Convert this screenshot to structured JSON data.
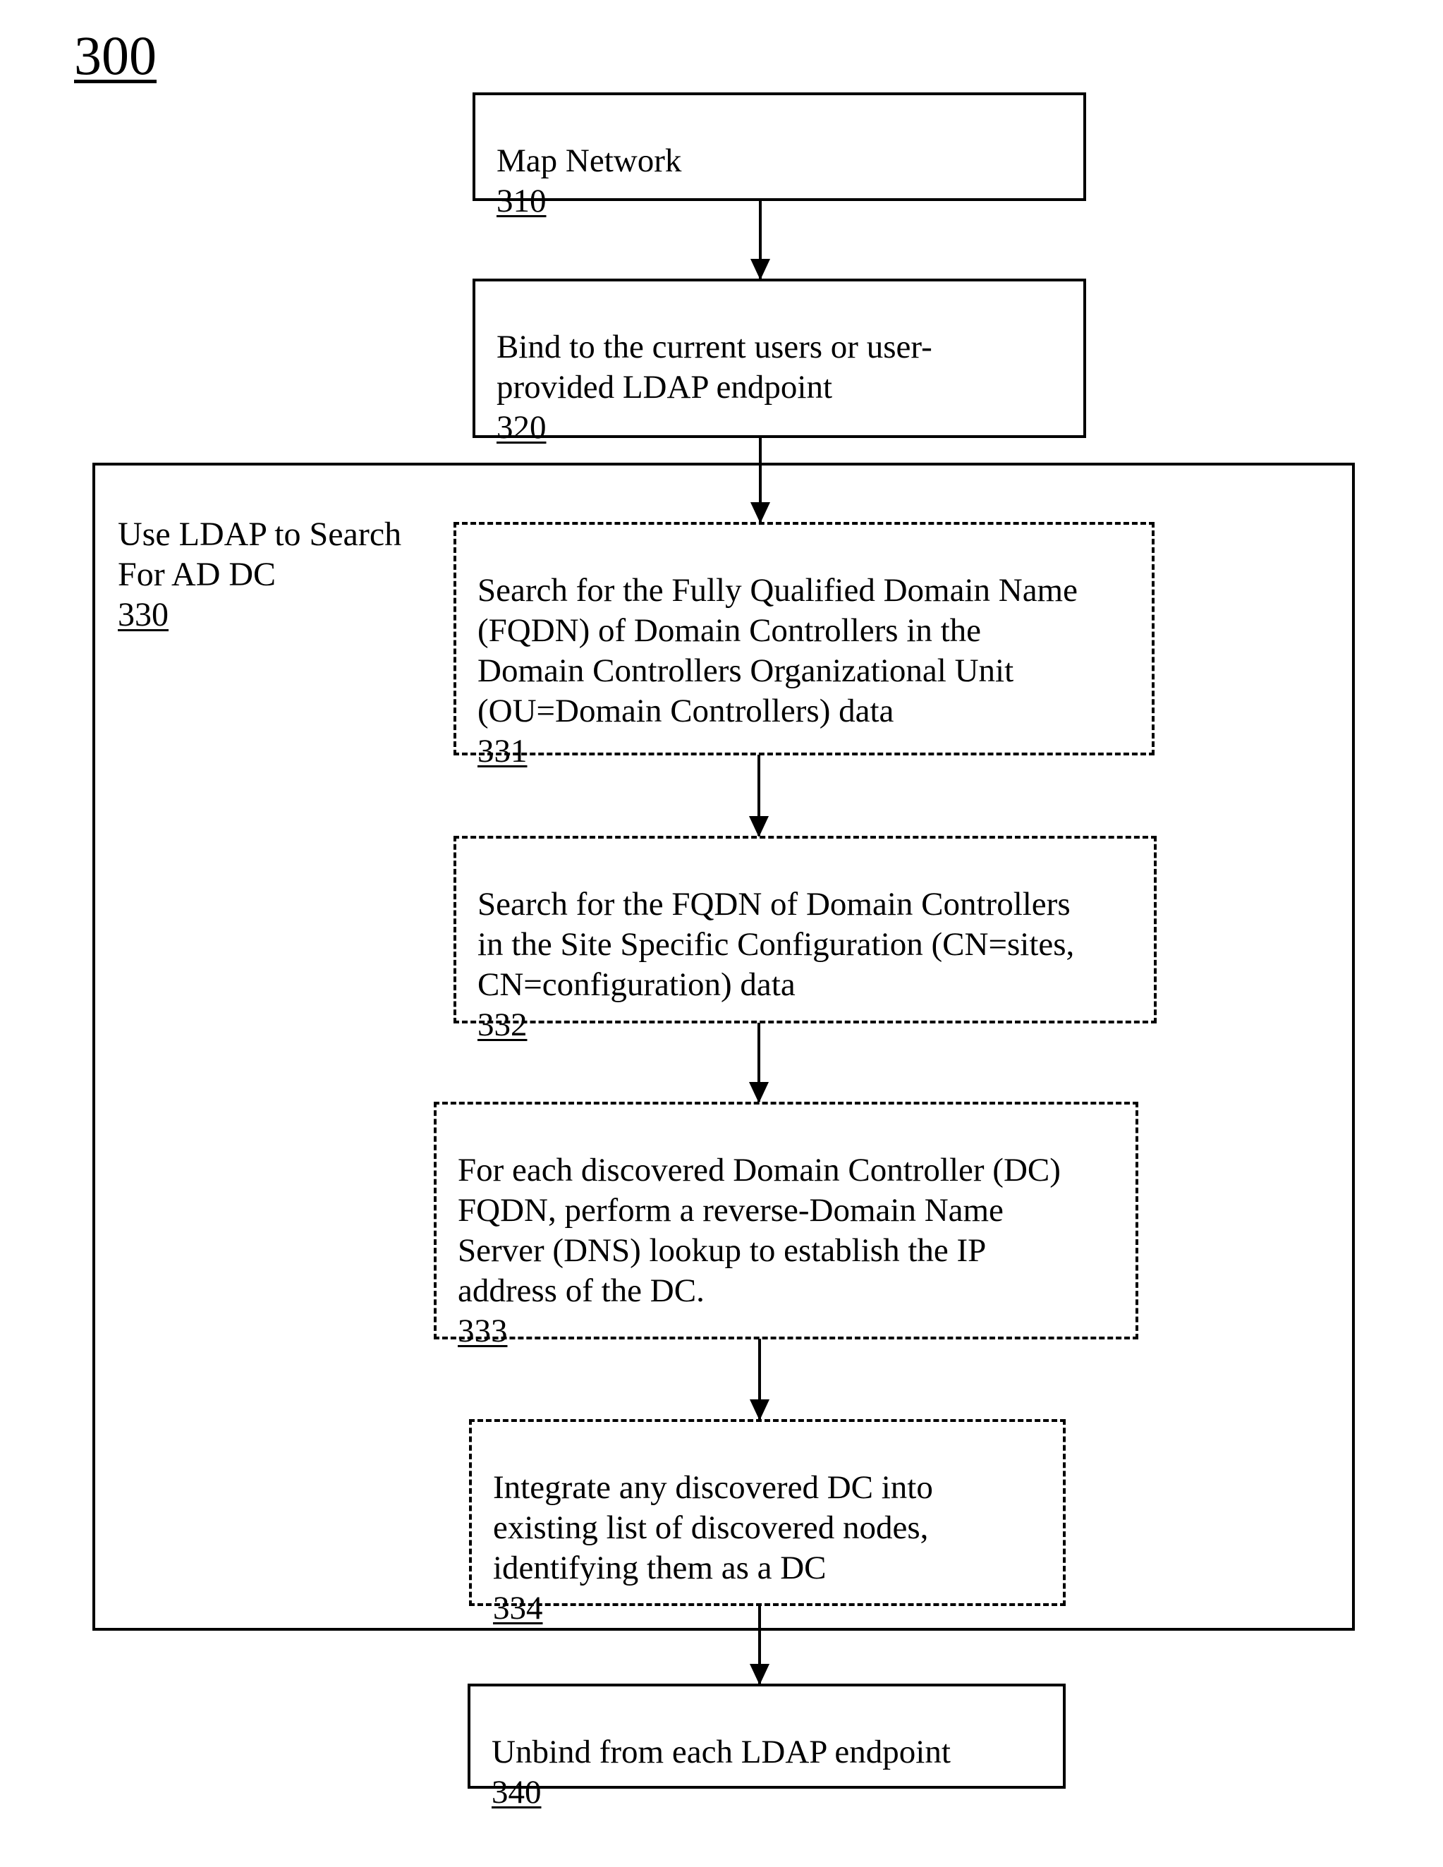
{
  "figure": {
    "label": "300"
  },
  "steps": {
    "s310": {
      "text": "Map Network",
      "ref": "310"
    },
    "s320": {
      "text": "Bind to the current users or user-\nprovided LDAP endpoint",
      "ref": "320"
    },
    "s330": {
      "text": "Use LDAP to Search\nFor AD DC",
      "ref": "330"
    },
    "s331": {
      "text": "Search for the Fully Qualified Domain Name\n(FQDN) of Domain Controllers in the\nDomain Controllers Organizational Unit\n(OU=Domain Controllers) data",
      "ref": "331"
    },
    "s332": {
      "text": "Search for the FQDN of Domain Controllers\nin the Site Specific Configuration (CN=sites,\nCN=configuration) data",
      "ref": "332"
    },
    "s333": {
      "text": "For each discovered Domain Controller (DC)\nFQDN, perform a reverse-Domain Name\nServer (DNS) lookup to establish the IP\naddress of the DC.",
      "ref": "333"
    },
    "s334": {
      "text": "Integrate any discovered DC into\nexisting list of discovered nodes,\nidentifying them as a DC",
      "ref": "334"
    },
    "s340": {
      "text": "Unbind from each LDAP endpoint",
      "ref": "340"
    }
  },
  "flow": [
    {
      "from": "310",
      "to": "320"
    },
    {
      "from": "320",
      "to": "331"
    },
    {
      "from": "331",
      "to": "332"
    },
    {
      "from": "332",
      "to": "333"
    },
    {
      "from": "333",
      "to": "334"
    },
    {
      "from": "334",
      "to": "340"
    }
  ]
}
